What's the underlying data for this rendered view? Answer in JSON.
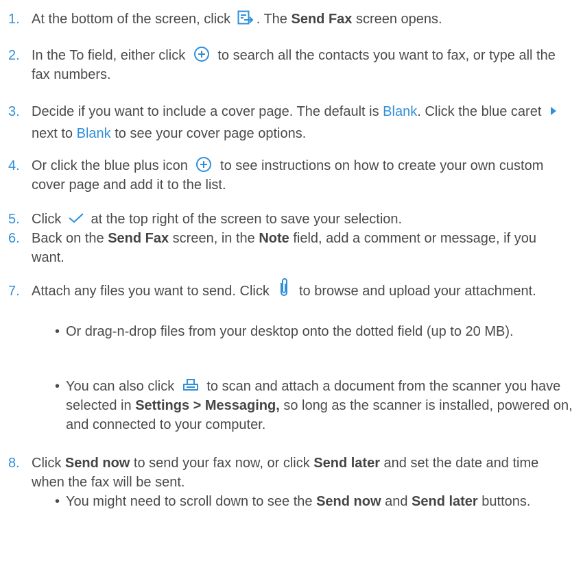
{
  "steps": [
    {
      "num": "1.",
      "t1": "At the bottom of the screen, click",
      "icon": "send-fax-icon",
      "t2": ". The",
      "bold1": "Send Fax",
      "t3": "screen opens."
    },
    {
      "num": "2.",
      "t1": "In the To field, either click",
      "icon": "plus-circle-icon",
      "t2": "to search all the contacts you want to fax, or type all the fax numbers."
    },
    {
      "num": "3.",
      "t1": "Decide if you want to include a cover page. The default is",
      "link1": "Blank",
      "t2": ". Click the blue caret",
      "icon": "caret-right-icon",
      "t3": "next to",
      "link2": "Blank",
      "t4": "to see your cover page options."
    },
    {
      "num": "4.",
      "t1": "Or click the blue plus icon",
      "icon": "plus-circle-icon",
      "t2": "to see instructions on how to create your own custom cover page and add it to the list."
    },
    {
      "num": "5.",
      "t1": "Click",
      "icon": "checkmark-icon",
      "t2": "at the top right of the screen to save your selection."
    },
    {
      "num": "6.",
      "t1": "Back on the",
      "bold1": "Send Fax",
      "t2": "screen, in the",
      "bold2": "Note",
      "t3": "field, add a comment or message, if you want."
    },
    {
      "num": "7.",
      "t1": "Attach any files you want to send. Click",
      "icon": "paperclip-icon",
      "t2": "to browse and upload your attachment.",
      "sub": [
        {
          "bullet": "•",
          "t1": "Or drag-n-drop files from your desktop onto the dotted field (up to 20 MB)."
        },
        {
          "bullet": "•",
          "t1": "You can also click",
          "icon": "scanner-icon",
          "t2": "to scan and attach a document from the scanner you have selected in",
          "bold1": "Settings > Messaging,",
          "t3": "so long as the scanner is installed, powered on, and connected to your computer."
        }
      ]
    },
    {
      "num": "8.",
      "t1": "Click",
      "bold1": "Send now",
      "t2": "to send your fax now, or click",
      "bold2": "Send later",
      "t3": "and set the date and time when the fax will be sent.",
      "sub": [
        {
          "bullet": "•",
          "t1": "You might need to scroll down to see the",
          "bold1": "Send now",
          "t2": "and",
          "bold2": "Send later",
          "t3": "buttons."
        }
      ]
    }
  ],
  "colors": {
    "accent": "#2f8fd8",
    "text": "#4a4a4a"
  }
}
